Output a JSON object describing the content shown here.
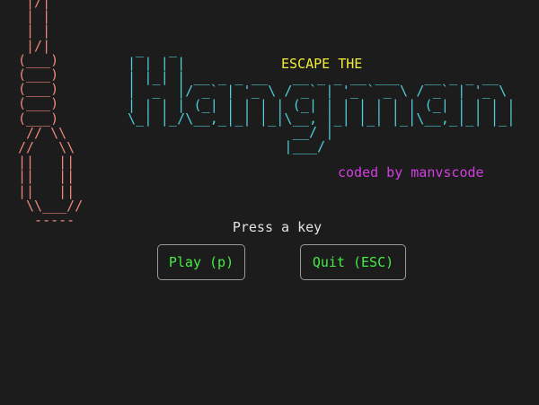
{
  "rope_art": " |/|\n | |\n | |\n |/|\n(___)\n(___)\n(___)\n(___)\n(___)\n // \\\\\n//   \\\\\n||   ||\n||   ||\n||   ||\n \\\\___//\n  -----",
  "logo_art": " _   _\n| | | |\n| |_| | __ _ _ __   __ _ _ __ ___   __ _ _ __\n|  _  |/ _` | '_ \\ / _` | '_ ` _ \\ / _` | '_ \\\n| | | | (_| | | | | (_| | | | | | | (_| | | | |\n\\_| |_/\\__,_|_| |_|\\__, |_| |_| |_|\\__,_|_| |_|\n                    __/ |\n                   |___/",
  "escape_title": "ESCAPE THE",
  "credit": "coded by manvscode",
  "prompt": "Press a key",
  "buttons": {
    "play": "Play (p)",
    "quit": "Quit (ESC)"
  },
  "colors": {
    "background": "#1c1c1c",
    "rope": "#f0877a",
    "logo": "#4fcfd9",
    "title": "#f2ec3a",
    "credit": "#d23fe0",
    "button_text": "#45ec45",
    "button_border": "#9a9a9a",
    "prompt": "#e2e2e2"
  }
}
